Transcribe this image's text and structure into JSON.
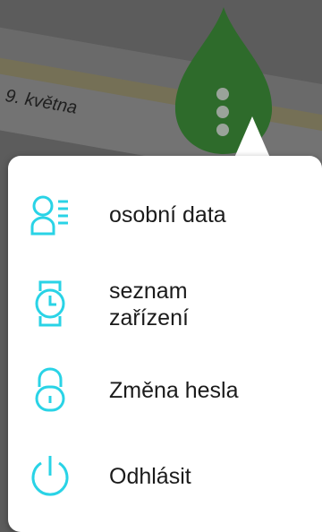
{
  "map": {
    "street_label": "9. května",
    "colors": {
      "background": "#5c5c5c",
      "road": "#6e6e6e",
      "road_accent": "#7a7350",
      "leaf": "#2e6b2b"
    }
  },
  "menu": {
    "accent_color": "#29d3e6",
    "items": [
      {
        "label": "osobní data",
        "icon": "user-list-icon"
      },
      {
        "label": "seznam\nzařízení",
        "icon": "watch-icon"
      },
      {
        "label": "Změna hesla",
        "icon": "lock-icon"
      },
      {
        "label": "Odhlásit",
        "icon": "power-icon"
      }
    ]
  }
}
